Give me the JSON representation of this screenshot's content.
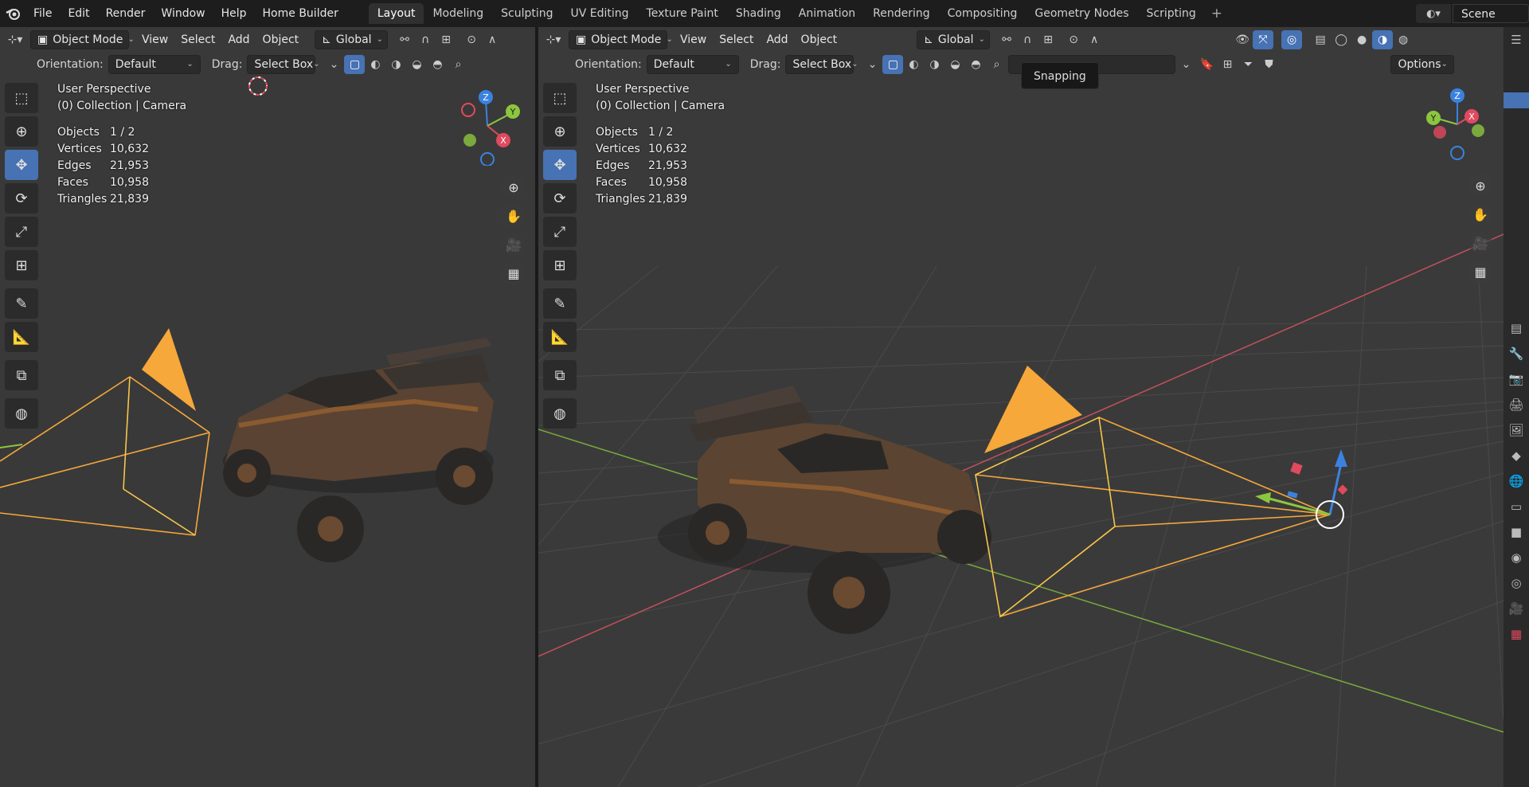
{
  "topbar": {
    "menus": [
      "File",
      "Edit",
      "Render",
      "Window",
      "Help",
      "Home Builder"
    ],
    "workspaces": [
      "Layout",
      "Modeling",
      "Sculpting",
      "UV Editing",
      "Texture Paint",
      "Shading",
      "Animation",
      "Rendering",
      "Compositing",
      "Geometry Nodes",
      "Scripting"
    ],
    "active_workspace": "Layout",
    "scene": "Scene"
  },
  "viewport_left": {
    "mode": "Object Mode",
    "menus": [
      "View",
      "Select",
      "Add",
      "Object"
    ],
    "transform": "Global",
    "orientation_label": "Orientation:",
    "orientation_value": "Default",
    "drag_label": "Drag:",
    "drag_value": "Select Box",
    "perspective": "User Perspective",
    "collection": "(0) Collection | Camera",
    "stats": [
      {
        "label": "Objects",
        "value": "1 / 2"
      },
      {
        "label": "Vertices",
        "value": "10,632"
      },
      {
        "label": "Edges",
        "value": "21,953"
      },
      {
        "label": "Faces",
        "value": "10,958"
      },
      {
        "label": "Triangles",
        "value": "21,839"
      }
    ]
  },
  "viewport_right": {
    "mode": "Object Mode",
    "menus": [
      "View",
      "Select",
      "Add",
      "Object"
    ],
    "transform": "Global",
    "orientation_label": "Orientation:",
    "orientation_value": "Default",
    "drag_label": "Drag:",
    "drag_value": "Select Box",
    "options": "Options",
    "tooltip": "Snapping",
    "perspective": "User Perspective",
    "collection": "(0) Collection | Camera",
    "stats": [
      {
        "label": "Objects",
        "value": "1 / 2"
      },
      {
        "label": "Vertices",
        "value": "10,632"
      },
      {
        "label": "Edges",
        "value": "21,953"
      },
      {
        "label": "Faces",
        "value": "10,958"
      },
      {
        "label": "Triangles",
        "value": "21,839"
      }
    ]
  },
  "gizmo": {
    "x": "X",
    "y": "Y",
    "z": "Z"
  },
  "colors": {
    "accent": "#4772b3",
    "camera": "#f6a83a",
    "x_axis": "#e04a5e",
    "y_axis": "#8cc63f",
    "z_axis": "#3b82e0"
  }
}
